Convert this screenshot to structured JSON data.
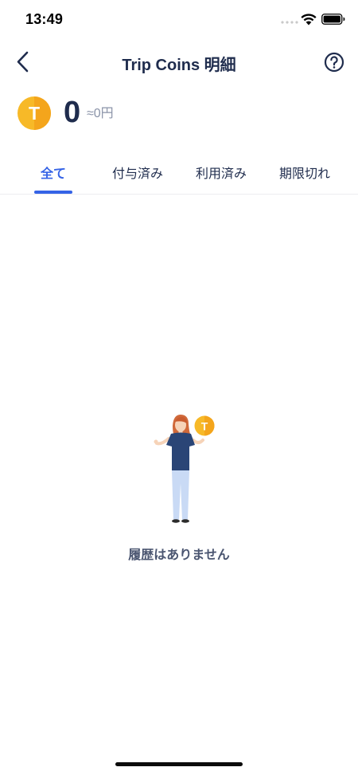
{
  "status_bar": {
    "time": "13:49"
  },
  "nav": {
    "title": "Trip Coins 明細"
  },
  "balance": {
    "amount": "0",
    "yen_equivalent": "≈0円",
    "coin_letter": "T"
  },
  "tabs": [
    {
      "label": "全て",
      "active": true
    },
    {
      "label": "付与済み",
      "active": false
    },
    {
      "label": "利用済み",
      "active": false
    },
    {
      "label": "期限切れ",
      "active": false
    }
  ],
  "empty_state": {
    "message": "履歴はありません",
    "coin_letter": "T"
  },
  "colors": {
    "accent": "#3563e6",
    "title": "#1f2c4d",
    "coin": "#f7b928",
    "muted": "#8a93a8"
  },
  "icons": {
    "back": "chevron-left-icon",
    "help": "question-circle-icon",
    "coin": "trip-coin-icon"
  }
}
